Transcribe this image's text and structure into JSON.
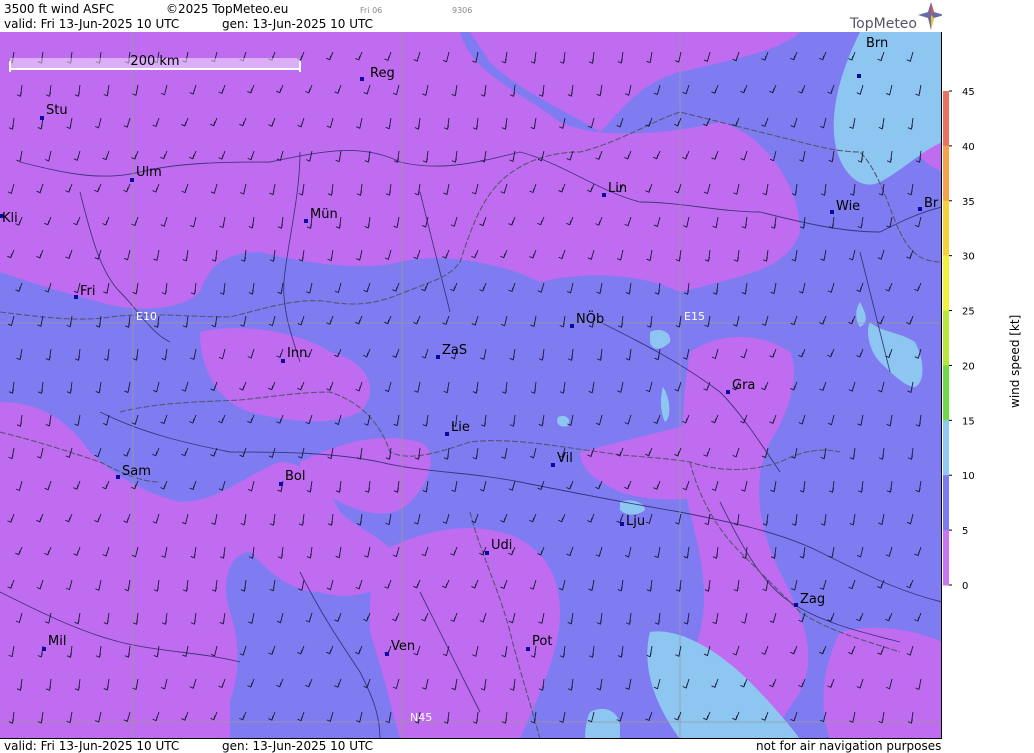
{
  "header": {
    "title": "3500 ft wind ASFC",
    "copyright": "©2025 TopMeteo.eu",
    "day_tag": "Fri 06",
    "code": "9306",
    "valid": "valid:  Fri  13-Jun-2025  10 UTC",
    "gen": "gen: 13-Jun-2025  10 UTC"
  },
  "logo": {
    "text": "TopMeteo"
  },
  "scale_bar": {
    "label": "200 km"
  },
  "gridlines": {
    "lon_e10": "E10",
    "lon_e15": "E15",
    "lat_n45": "N45"
  },
  "cities": [
    {
      "name": "Brn"
    },
    {
      "name": "Reg"
    },
    {
      "name": "Stu"
    },
    {
      "name": "Ulm"
    },
    {
      "name": "Kli"
    },
    {
      "name": "Mün"
    },
    {
      "name": "Lin"
    },
    {
      "name": "Wie"
    },
    {
      "name": "Br"
    },
    {
      "name": "Fri"
    },
    {
      "name": "NÖb"
    },
    {
      "name": "Inn"
    },
    {
      "name": "ZaS"
    },
    {
      "name": "Gra"
    },
    {
      "name": "Lie"
    },
    {
      "name": "Vil"
    },
    {
      "name": "Sam"
    },
    {
      "name": "Bol"
    },
    {
      "name": "Lju"
    },
    {
      "name": "Udi"
    },
    {
      "name": "Zag"
    },
    {
      "name": "Mil"
    },
    {
      "name": "Ven"
    },
    {
      "name": "Pot"
    }
  ],
  "legend": {
    "unit": "wind  speed  [kt]",
    "ticks": [
      "45",
      "40",
      "35",
      "30",
      "25",
      "20",
      "15",
      "10",
      "5",
      "0"
    ],
    "colors": [
      "#e8735f",
      "#f5a14a",
      "#f7d13c",
      "#f2f23a",
      "#b8e63a",
      "#6ed94a",
      "#b8f2f0",
      "#8ec9f0",
      "#7b7bf0",
      "#c877f0"
    ]
  },
  "footer": {
    "valid": "valid:  Fri  13-Jun-2025  10 UTC",
    "gen": "gen: 13-Jun-2025  10 UTC",
    "disclaimer": "not for air navigation purposes"
  },
  "palette": {
    "violet": "#c06cf0",
    "blue": "#7f7cf2",
    "lightblue": "#8ec6f2"
  }
}
